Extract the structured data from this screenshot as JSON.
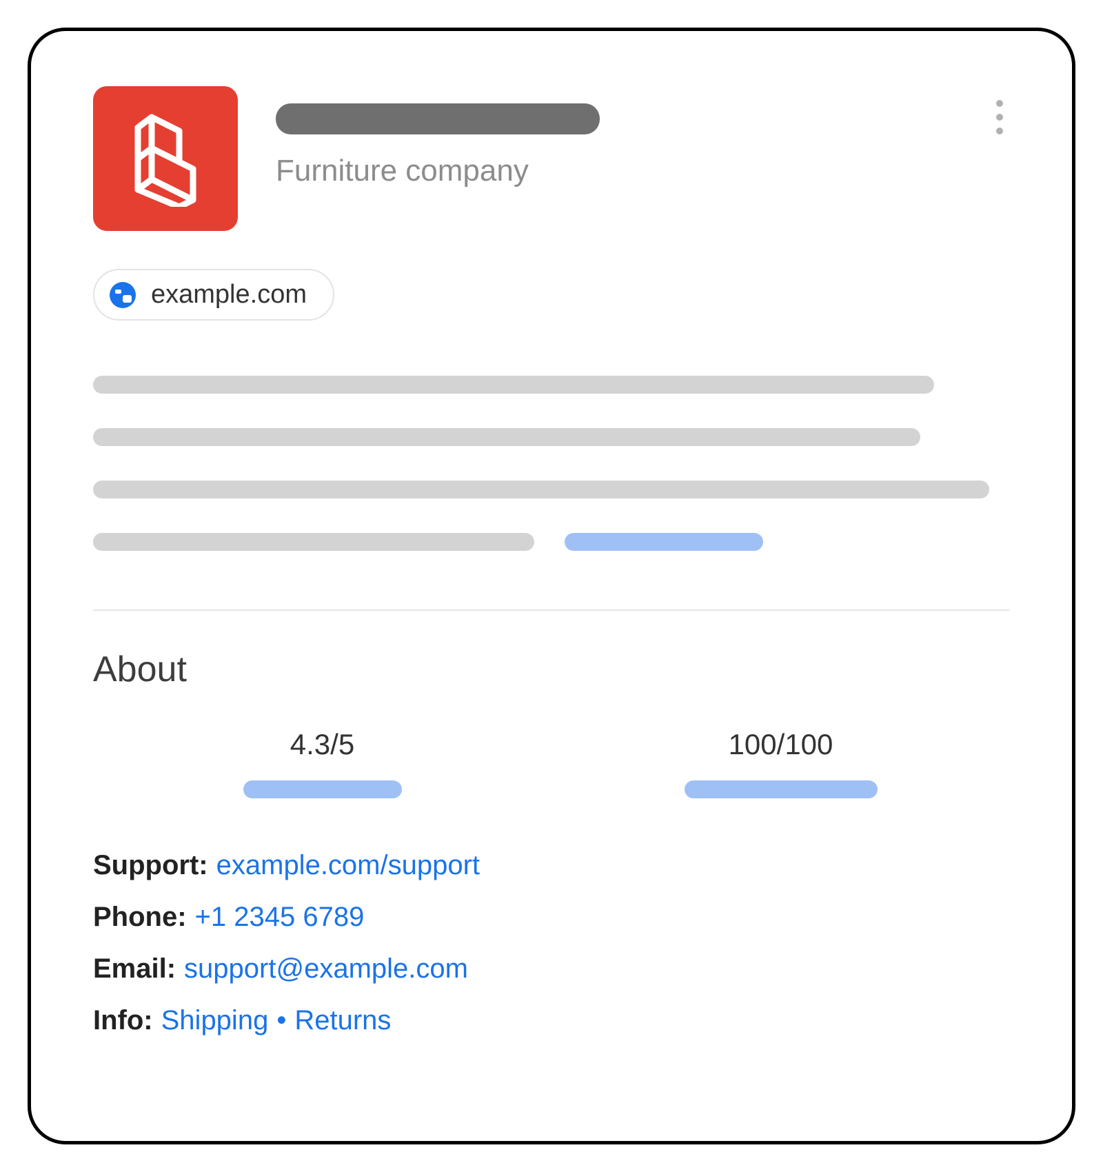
{
  "header": {
    "subtitle": "Furniture company",
    "website": "example.com"
  },
  "about": {
    "heading": "About",
    "stat1": "4.3/5",
    "stat2": "100/100"
  },
  "contact": {
    "support_label": "Support:",
    "support_link": "example.com/support",
    "phone_label": "Phone:",
    "phone_link": "+1 2345 6789",
    "email_label": "Email:",
    "email_link": "support@example.com",
    "info_label": "Info:",
    "info_link_shipping": "Shipping",
    "info_sep": "•",
    "info_link_returns": "Returns"
  }
}
